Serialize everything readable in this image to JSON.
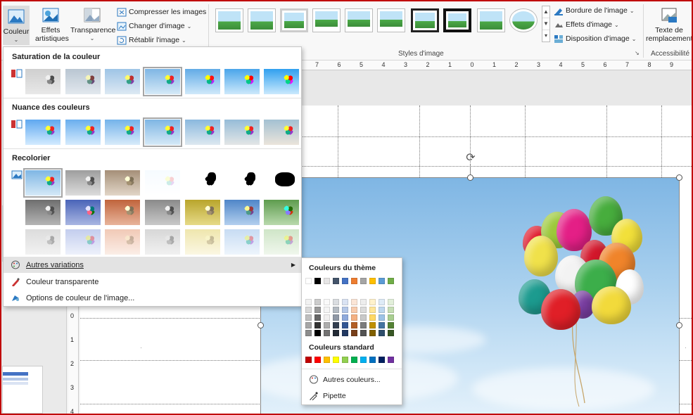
{
  "ribbon": {
    "couleur": {
      "label": "Couleur"
    },
    "effets": {
      "label1": "Effets",
      "label2": "artistiques"
    },
    "transparence": {
      "label": "Transparence"
    },
    "ajuster": [
      "Compresser les images",
      "Changer d'image",
      "Rétablir l'image"
    ],
    "styles_label": "Styles d'image",
    "style_right": [
      "Bordure de l'image",
      "Effets d'image",
      "Disposition d'image"
    ],
    "accessibility": {
      "btn1": "Texte de",
      "btn2": "remplacement",
      "group": "Accessibilité"
    }
  },
  "ruler_top": [
    "7",
    "6",
    "5",
    "4",
    "3",
    "2",
    "1",
    "0",
    "1",
    "2",
    "3",
    "4",
    "5",
    "6",
    "7",
    "8",
    "9"
  ],
  "ruler_left": [
    "0",
    "1",
    "2",
    "3",
    "4"
  ],
  "menu": {
    "saturation_title": "Saturation de la couleur",
    "nuance_title": "Nuance des couleurs",
    "recolor_title": "Recolorier",
    "items": [
      {
        "label": "Autres variations"
      },
      {
        "label": "Couleur transparente"
      },
      {
        "label": "Options de couleur de l'image..."
      }
    ]
  },
  "submenu": {
    "theme_title": "Couleurs du thème",
    "standard_title": "Couleurs standard",
    "more_colors": "Autres couleurs...",
    "pipette": "Pipette",
    "theme_colors": [
      "#ffffff",
      "#000000",
      "#e7e6e6",
      "#44546a",
      "#4472c4",
      "#ed7d31",
      "#a5a5a5",
      "#ffc000",
      "#5b9bd5",
      "#70ad47"
    ],
    "standard_colors": [
      "#c00000",
      "#ff0000",
      "#ffc000",
      "#ffff00",
      "#92d050",
      "#00b050",
      "#00b0f0",
      "#0070c0",
      "#002060",
      "#7030a0"
    ]
  },
  "colors": {
    "accent": "#c00000",
    "menu_highlight": "#e3e3e3"
  }
}
